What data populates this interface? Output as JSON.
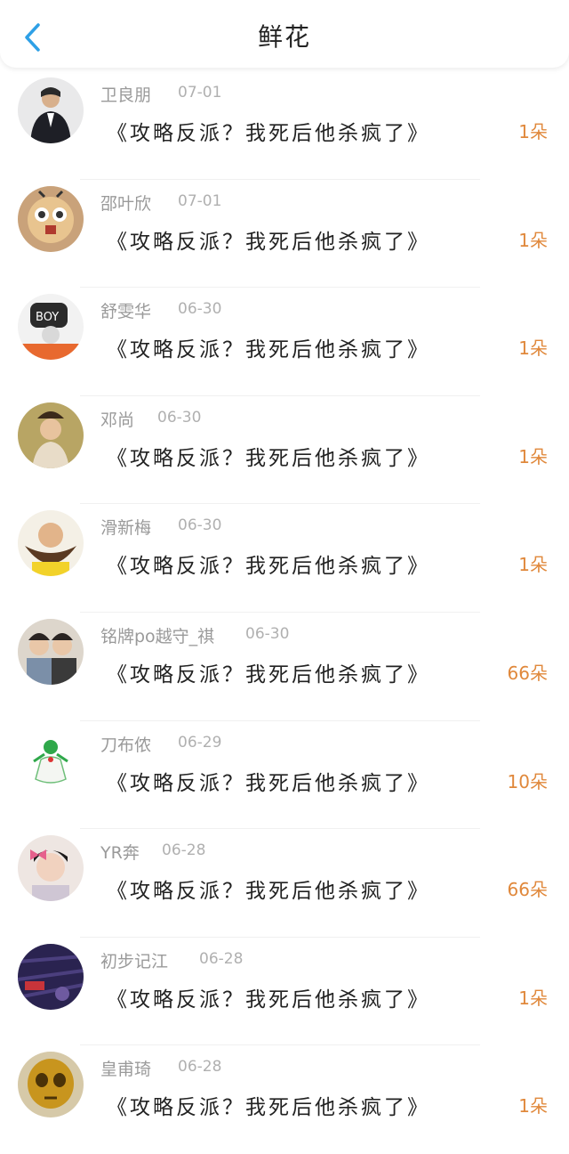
{
  "header": {
    "title": "鲜花"
  },
  "records": [
    {
      "name": "卫良朋",
      "date": "07-01",
      "book": "《攻略反派？我死后他杀疯了》",
      "count": "1朵"
    },
    {
      "name": "邵叶欣",
      "date": "07-01",
      "book": "《攻略反派？我死后他杀疯了》",
      "count": "1朵"
    },
    {
      "name": "舒雯华",
      "date": "06-30",
      "book": "《攻略反派？我死后他杀疯了》",
      "count": "1朵"
    },
    {
      "name": "邓尚",
      "date": "06-30",
      "book": "《攻略反派？我死后他杀疯了》",
      "count": "1朵"
    },
    {
      "name": "滑新梅",
      "date": "06-30",
      "book": "《攻略反派？我死后他杀疯了》",
      "count": "1朵"
    },
    {
      "name": "铭牌po越守_祺",
      "date": "06-30",
      "book": "《攻略反派？我死后他杀疯了》",
      "count": "66朵"
    },
    {
      "name": "刀布侬",
      "date": "06-29",
      "book": "《攻略反派？我死后他杀疯了》",
      "count": "10朵"
    },
    {
      "name": "YR奔",
      "date": "06-28",
      "book": "《攻略反派？我死后他杀疯了》",
      "count": "66朵"
    },
    {
      "name": "初步记江",
      "date": "06-28",
      "book": "《攻略反派？我死后他杀疯了》",
      "count": "1朵"
    },
    {
      "name": "皇甫琦",
      "date": "06-28",
      "book": "《攻略反派？我死后他杀疯了》",
      "count": "1朵"
    }
  ],
  "colors": {
    "accent": "#2ea0e6",
    "count": "#e0883b",
    "muted": "#9a9a9a"
  }
}
